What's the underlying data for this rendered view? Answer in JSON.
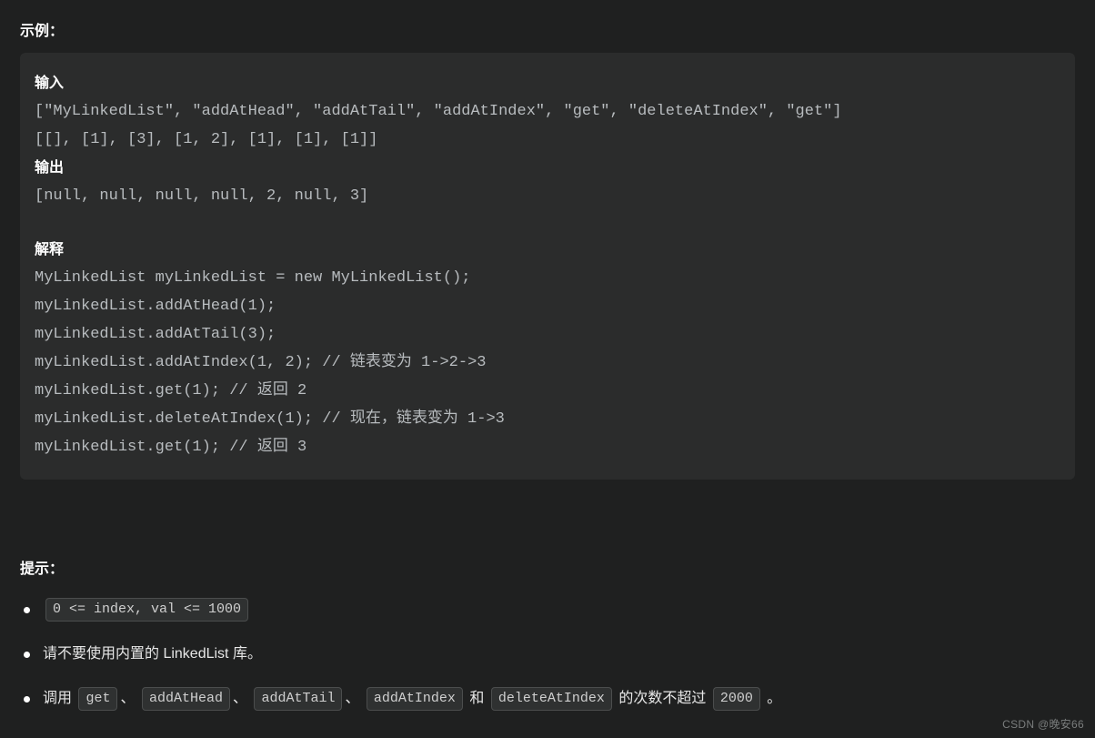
{
  "example": {
    "heading": "示例：",
    "labels": {
      "input": "输入",
      "output": "输出",
      "explain": "解释"
    },
    "input_ops": "[\"MyLinkedList\", \"addAtHead\", \"addAtTail\", \"addAtIndex\", \"get\", \"deleteAtIndex\", \"get\"]",
    "input_args": "[[], [1], [3], [1, 2], [1], [1], [1]]",
    "output": "[null, null, null, null, 2, null, 3]",
    "explain_lines": {
      "l1": "MyLinkedList myLinkedList = new MyLinkedList();",
      "l2": "myLinkedList.addAtHead(1);",
      "l3": "myLinkedList.addAtTail(3);",
      "l4": "myLinkedList.addAtIndex(1, 2);    // 链表变为 1->2->3",
      "l5": "myLinkedList.get(1);              // 返回 2",
      "l6": "myLinkedList.deleteAtIndex(1);    // 现在，链表变为 1->3",
      "l7": "myLinkedList.get(1);              // 返回 3"
    }
  },
  "tips": {
    "heading": "提示：",
    "item1_code": "0 <= index, val <= 1000",
    "item2_pre": "请不要使用内置的 LinkedList 库。",
    "item3": {
      "pre": "调用",
      "c1": "get",
      "sep": "、",
      "c2": "addAtHead",
      "c3": "addAtTail",
      "c4": "addAtIndex",
      "and": "和",
      "c5": "deleteAtIndex",
      "mid": "的次数不超过",
      "limit": "2000",
      "end": "。"
    }
  },
  "watermark": "CSDN @晚安66"
}
